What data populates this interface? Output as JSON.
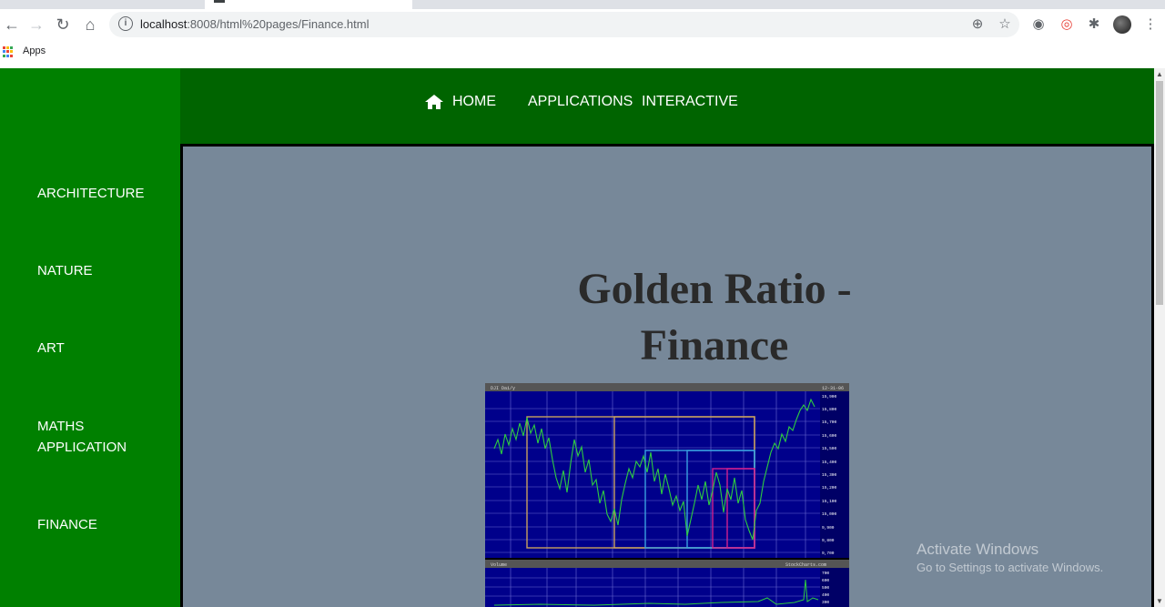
{
  "browser": {
    "url_host": "localhost",
    "url_path": ":8008/html%20pages/Finance.html",
    "bookmarks": {
      "apps_label": "Apps"
    }
  },
  "nav": {
    "home": "HOME",
    "applications": "APPLICATIONS",
    "interactive": "INTERACTIVE"
  },
  "sidebar": {
    "items": [
      {
        "label": "ARCHITECTURE"
      },
      {
        "label": "NATURE"
      },
      {
        "label": "ART"
      },
      {
        "label": "MATHS APPLICATION"
      },
      {
        "label": "FINANCE"
      }
    ]
  },
  "main": {
    "title_line1": "Golden Ratio -",
    "title_line2": "Finance",
    "chart_image": {
      "header_left": "DJI Dai/y",
      "header_right": "12-31-06",
      "price_ticks": [
        "15,900",
        "15,800",
        "15,700",
        "15,600",
        "15,500",
        "15,400",
        "15,300",
        "15,200",
        "15,100",
        "15,000",
        "9,900",
        "9,800",
        "9,700"
      ],
      "volume_label": "Volume",
      "volume_source": "StockCharts.com",
      "volume_ticks": [
        "700",
        "600",
        "500",
        "400",
        "300"
      ]
    }
  },
  "os_watermark": {
    "line1": "Activate Windows",
    "line2": "Go to Settings to activate Windows."
  },
  "colors": {
    "sidebar": "#008000",
    "topnav": "#006400",
    "content": "#778899",
    "chart_bg": "#000080",
    "price_line": "#2ecc40"
  }
}
